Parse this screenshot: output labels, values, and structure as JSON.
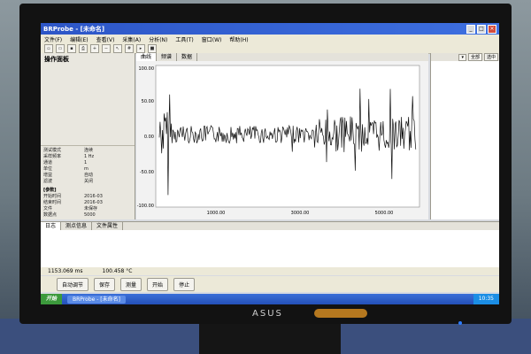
{
  "window": {
    "title": "BRProbe - [未命名]",
    "min": "_",
    "max": "□",
    "close": "×"
  },
  "menu": [
    "文件(F)",
    "编辑(E)",
    "查看(V)",
    "采集(A)",
    "分析(N)",
    "工具(T)",
    "窗口(W)",
    "帮助(H)"
  ],
  "left_panel": {
    "title": "操作面板",
    "props": [
      {
        "k": "测试模式",
        "v": "连续"
      },
      {
        "k": "采样频率",
        "v": "1 Hz"
      },
      {
        "k": "通道",
        "v": "1"
      },
      {
        "k": "单位",
        "v": "m"
      },
      {
        "k": "增益",
        "v": "自动"
      },
      {
        "k": "滤波",
        "v": "关闭"
      }
    ],
    "section2": "[参数]",
    "props2": [
      {
        "k": "开始时间",
        "v": "2016-03"
      },
      {
        "k": "结束时间",
        "v": "2016-03"
      },
      {
        "k": "文件",
        "v": "未保存"
      },
      {
        "k": "数据点",
        "v": "5000"
      }
    ]
  },
  "plot_tabs": [
    "曲线",
    "频谱",
    "数据"
  ],
  "y_ticks": [
    "100.00",
    "50.00",
    "0.00",
    "-50.00",
    "-100.00"
  ],
  "x_ticks": [
    "1000.00",
    "3000.00",
    "5000.00"
  ],
  "trace_color": "#111111",
  "right_panel": {
    "buttons": [
      "▾",
      "全部",
      "选中"
    ]
  },
  "bottom_tabs": [
    "日志",
    "测点信息",
    "文件属性"
  ],
  "readout": {
    "x": "1153.069 ms",
    "y": "100.458 °C"
  },
  "actions": [
    "自动调节",
    "保存",
    "测量",
    "开始",
    "停止"
  ],
  "taskbar": {
    "start": "开始",
    "task": "BRProbe - [未命名]",
    "tray": "10:35"
  },
  "monitor": {
    "brand": "ASUS"
  }
}
